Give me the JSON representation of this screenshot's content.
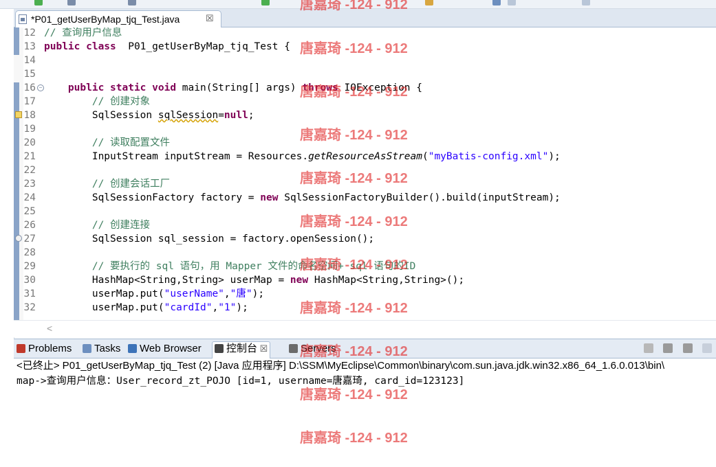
{
  "editor_tab": {
    "title": "*P01_getUserByMap_tjq_Test.java",
    "close": "☒"
  },
  "code_lines": [
    {
      "n": "12",
      "parts": [
        [
          "cm",
          "// 查询用户信息"
        ]
      ]
    },
    {
      "n": "13",
      "parts": [
        [
          "kw",
          "public class"
        ],
        [
          "",
          "  P01_getUserByMap_tjq_Test {"
        ]
      ]
    },
    {
      "n": "14",
      "parts": []
    },
    {
      "n": "15",
      "parts": []
    },
    {
      "n": "16",
      "fold": true,
      "parts": [
        [
          "",
          "    "
        ],
        [
          "kw",
          "public static void"
        ],
        [
          "",
          " main(String[] args) "
        ],
        [
          "kw",
          "throws"
        ],
        [
          "",
          " IOException {"
        ]
      ]
    },
    {
      "n": "17",
      "parts": [
        [
          "",
          "        "
        ],
        [
          "cm",
          "// 创建对象"
        ]
      ]
    },
    {
      "n": "18",
      "marker": "warn",
      "parts": [
        [
          "",
          "        SqlSession "
        ],
        [
          "squig",
          "sqlSession"
        ],
        [
          "",
          "="
        ],
        [
          "kw",
          "null"
        ],
        [
          "",
          ";"
        ]
      ]
    },
    {
      "n": "19",
      "parts": []
    },
    {
      "n": "20",
      "parts": [
        [
          "",
          "        "
        ],
        [
          "cm",
          "// 读取配置文件"
        ]
      ]
    },
    {
      "n": "21",
      "parts": [
        [
          "",
          "        InputStream inputStream = Resources."
        ],
        [
          "it",
          "getResourceAsStream"
        ],
        [
          "",
          "("
        ],
        [
          "st",
          "\"myBatis-config.xml\""
        ],
        [
          "",
          ");"
        ]
      ]
    },
    {
      "n": "22",
      "parts": []
    },
    {
      "n": "23",
      "parts": [
        [
          "",
          "        "
        ],
        [
          "cm",
          "// 创建会话工厂"
        ]
      ]
    },
    {
      "n": "24",
      "parts": [
        [
          "",
          "        SqlSessionFactory factory = "
        ],
        [
          "kw",
          "new"
        ],
        [
          "",
          " SqlSessionFactoryBuilder().build(inputStream);"
        ]
      ]
    },
    {
      "n": "25",
      "parts": []
    },
    {
      "n": "26",
      "parts": [
        [
          "",
          "        "
        ],
        [
          "cm",
          "// 创建连接"
        ]
      ]
    },
    {
      "n": "27",
      "marker": "info",
      "parts": [
        [
          "",
          "        SqlSession sql_session = factory.openSession();"
        ]
      ]
    },
    {
      "n": "28",
      "parts": []
    },
    {
      "n": "29",
      "parts": [
        [
          "",
          "        "
        ],
        [
          "cm",
          "// 要执行的 sql 语句，用 Mapper 文件的命名空间+ sql 语句的ID"
        ]
      ]
    },
    {
      "n": "30",
      "parts": [
        [
          "",
          "        HashMap<String,String> userMap = "
        ],
        [
          "kw",
          "new"
        ],
        [
          "",
          " HashMap<String,String>();"
        ]
      ]
    },
    {
      "n": "31",
      "parts": [
        [
          "",
          "        userMap.put("
        ],
        [
          "st",
          "\"userName\""
        ],
        [
          "",
          ","
        ],
        [
          "st",
          "\"唐\""
        ],
        [
          "",
          ");"
        ]
      ]
    },
    {
      "n": "32",
      "parts": [
        [
          "",
          "        userMap.put("
        ],
        [
          "st",
          "\"cardId\""
        ],
        [
          "",
          ","
        ],
        [
          "st",
          "\"1\""
        ],
        [
          "",
          ");"
        ]
      ]
    }
  ],
  "panel_tabs": [
    {
      "label": "Problems",
      "icon": "problems-icon",
      "color": "#c0392b"
    },
    {
      "label": "Tasks",
      "icon": "tasks-icon",
      "color": "#6d8fbf"
    },
    {
      "label": "Web Browser",
      "icon": "web-browser-icon",
      "color": "#3d73b8"
    },
    {
      "label": "控制台",
      "icon": "console-icon",
      "color": "#444444",
      "active": true,
      "close": "☒"
    },
    {
      "label": "Servers",
      "icon": "servers-icon",
      "color": "#6b6b6b"
    }
  ],
  "console": {
    "title": "<已终止> P01_getUserByMap_tjq_Test (2)  [Java 应用程序] D:\\SSM\\MyEclipse\\Common\\binary\\com.sun.java.jdk.win32.x86_64_1.6.0.013\\bin\\",
    "output": "map->查询用户信息：User_record_zt_POJO [id=1, username=唐嘉琦, card_id=123123]"
  },
  "watermark": "唐嘉琦 -124 - 912",
  "colors": {
    "keyword": "#7f0055",
    "comment": "#3f7f5f",
    "string": "#2a00ff",
    "watermark": "#e02828"
  }
}
